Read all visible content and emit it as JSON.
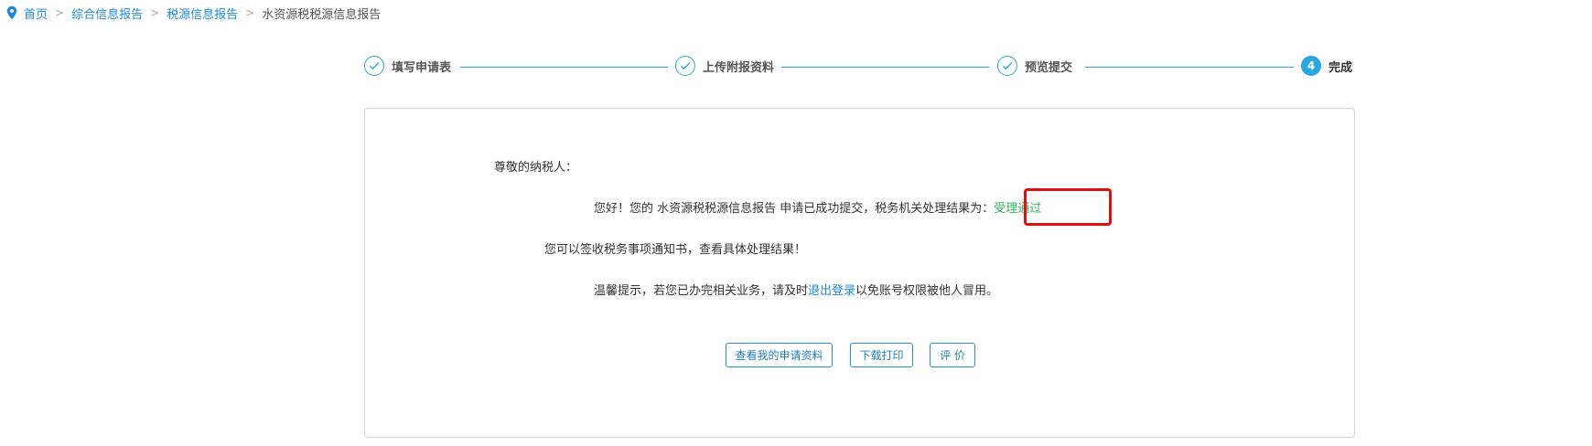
{
  "breadcrumb": {
    "home": "首页",
    "level1": "综合信息报告",
    "level2": "税源信息报告",
    "current": "水资源税税源信息报告",
    "separator": ">"
  },
  "steps": [
    {
      "label": "填写申请表",
      "status": "done"
    },
    {
      "label": "上传附报资料",
      "status": "done"
    },
    {
      "label": "预览提交",
      "status": "done"
    },
    {
      "label": "完成",
      "status": "active",
      "number": "4"
    }
  ],
  "result": {
    "greeting": "尊敬的纳税人：",
    "line1_prefix": "您好！您的 水资源税税源信息报告 申请已成功提交，税务机关处理结果为：",
    "status": "受理通过",
    "line2": "您可以签收税务事项通知书，查看具体处理结果！",
    "tip_prefix": "温馨提示，若您已办完相关业务，请及时",
    "logout_link": "退出登录",
    "tip_suffix": "以免账号权限被他人冒用。"
  },
  "buttons": {
    "view_materials": "查看我的申请资料",
    "download_print": "下载打印",
    "evaluate": "评 价"
  },
  "colors": {
    "accent": "#2aa6e0",
    "link": "#1e88d9",
    "success": "#2fb35a",
    "highlight": "#e01010"
  },
  "icons": {
    "breadcrumb_home": "location-pin-icon",
    "step_done": "check-circle-icon"
  }
}
